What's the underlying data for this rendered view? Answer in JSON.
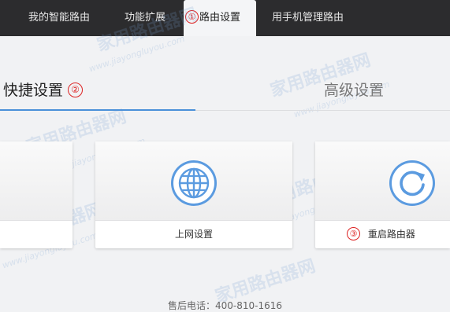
{
  "topnav": {
    "tabs": [
      {
        "label": "我的智能路由"
      },
      {
        "label": "功能扩展"
      },
      {
        "label": "路由设置",
        "marker": "①"
      },
      {
        "label": "用手机管理路由"
      }
    ],
    "active_index": 2
  },
  "subnav": {
    "quick": {
      "label": "快捷设置",
      "marker": "②"
    },
    "advanced": {
      "label": "高级设置"
    }
  },
  "cards": [
    {
      "label": "",
      "icon": "blank"
    },
    {
      "label": "上网设置",
      "icon": "globe-icon"
    },
    {
      "label": "重启路由器",
      "icon": "refresh-icon",
      "marker": "③"
    }
  ],
  "footer": {
    "text": "售后电话：400-810-1616"
  },
  "watermark": {
    "cn": "家用路由器网",
    "en": "www.jiayongluyou.com"
  },
  "colors": {
    "accent": "#4a90d9",
    "marker": "#dd2222",
    "topbar": "#2c2c2e"
  }
}
